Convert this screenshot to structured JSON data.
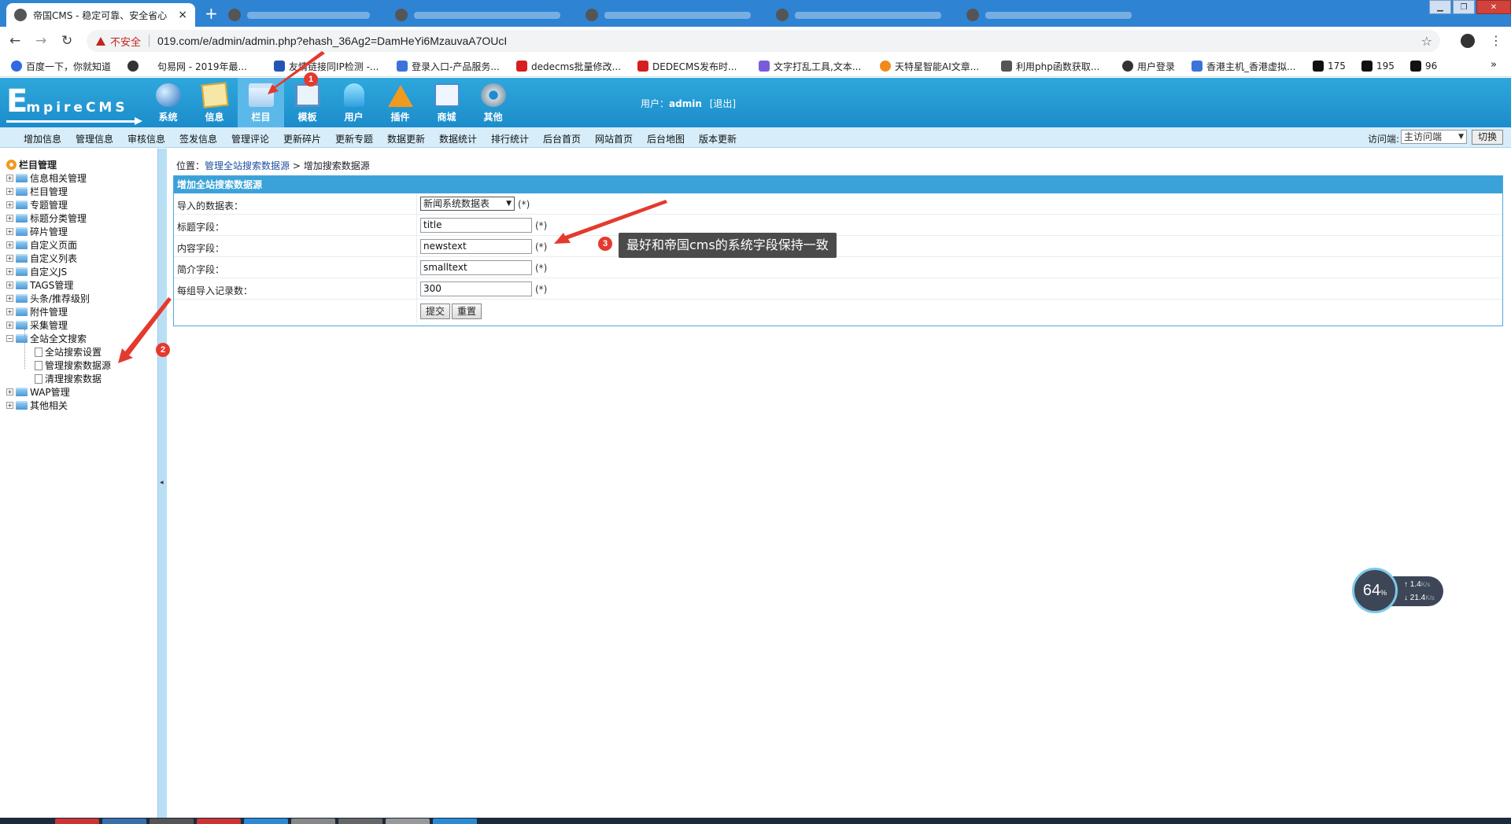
{
  "browser": {
    "active_tab_title": "帝国CMS - 稳定可靠、安全省心",
    "address": {
      "insecure_label": "不安全",
      "url": "019.com/e/admin/admin.php?ehash_36Ag2=DamHeYi6MzauvaA7OUcI"
    },
    "bookmarks": [
      "百度一下，你就知道",
      "",
      "句易网 - 2019年最...",
      "友情链接同IP检测 -...",
      "登录入口-产品服务...",
      "dedecms批量修改...",
      "DEDECMS发布时...",
      "文字打乱工具,文本...",
      "天特星智能AI文章...",
      "利用php函数获取...",
      "用户登录",
      "香港主机_香港虚拟...",
      "175",
      "195",
      "96"
    ],
    "bookmarks_more": "»"
  },
  "cms": {
    "logo_initial": "E",
    "logo_rest": "mpireCMS",
    "nav": [
      {
        "label": "系统",
        "icon": "globe-icon"
      },
      {
        "label": "信息",
        "icon": "note-icon"
      },
      {
        "label": "栏目",
        "icon": "folder-icon"
      },
      {
        "label": "模板",
        "icon": "window-icon"
      },
      {
        "label": "用户",
        "icon": "user-icon"
      },
      {
        "label": "插件",
        "icon": "plugin-icon"
      },
      {
        "label": "商城",
        "icon": "shop-icon"
      },
      {
        "label": "其他",
        "icon": "gear-icon"
      }
    ],
    "user_prefix": "用户：",
    "user_name": "admin",
    "logout": "[退出]",
    "subnav": [
      "增加信息",
      "管理信息",
      "审核信息",
      "签发信息",
      "管理评论",
      "更新碎片",
      "更新专题",
      "数据更新",
      "数据统计",
      "排行统计",
      "后台首页",
      "网站首页",
      "后台地图",
      "版本更新"
    ],
    "visit_label": "访问端:",
    "visit_value": "主访问端",
    "switch_label": "切换"
  },
  "tree": {
    "root": "栏目管理",
    "items": [
      "信息相关管理",
      "栏目管理",
      "专题管理",
      "标题分类管理",
      "碎片管理",
      "自定义页面",
      "自定义列表",
      "自定义JS",
      "TAGS管理",
      "头条/推荐级别",
      "附件管理",
      "采集管理",
      "全站全文搜索"
    ],
    "children": [
      "全站搜索设置",
      "管理搜索数据源",
      "清理搜索数据"
    ],
    "after": [
      "WAP管理",
      "其他相关"
    ]
  },
  "main": {
    "breadcrumb_prefix": "位置：",
    "breadcrumb_link": "管理全站搜索数据源",
    "breadcrumb_sep": " > ",
    "breadcrumb_current": "增加搜索数据源",
    "form_title": "增加全站搜索数据源",
    "rows": [
      {
        "label": "导入的数据表：",
        "value": "新闻系统数据表",
        "required": "(*)"
      },
      {
        "label": "标题字段：",
        "value": "title",
        "required": "(*)"
      },
      {
        "label": "内容字段：",
        "value": "newstext",
        "required": "(*)"
      },
      {
        "label": "简介字段：",
        "value": "smalltext",
        "required": "(*)"
      },
      {
        "label": "每组导入记录数：",
        "value": "300",
        "required": "(*)"
      }
    ],
    "submit": "提交",
    "reset": "重置"
  },
  "annotations": {
    "badges": [
      "1",
      "2",
      "3"
    ],
    "tooltip": "最好和帝国cms的系统字段保持一致",
    "color": "#e43a2e"
  },
  "netspeed": {
    "percent": "64",
    "percent_unit": "%",
    "up": "1.4",
    "down": "21.4",
    "unit": "K/s"
  }
}
